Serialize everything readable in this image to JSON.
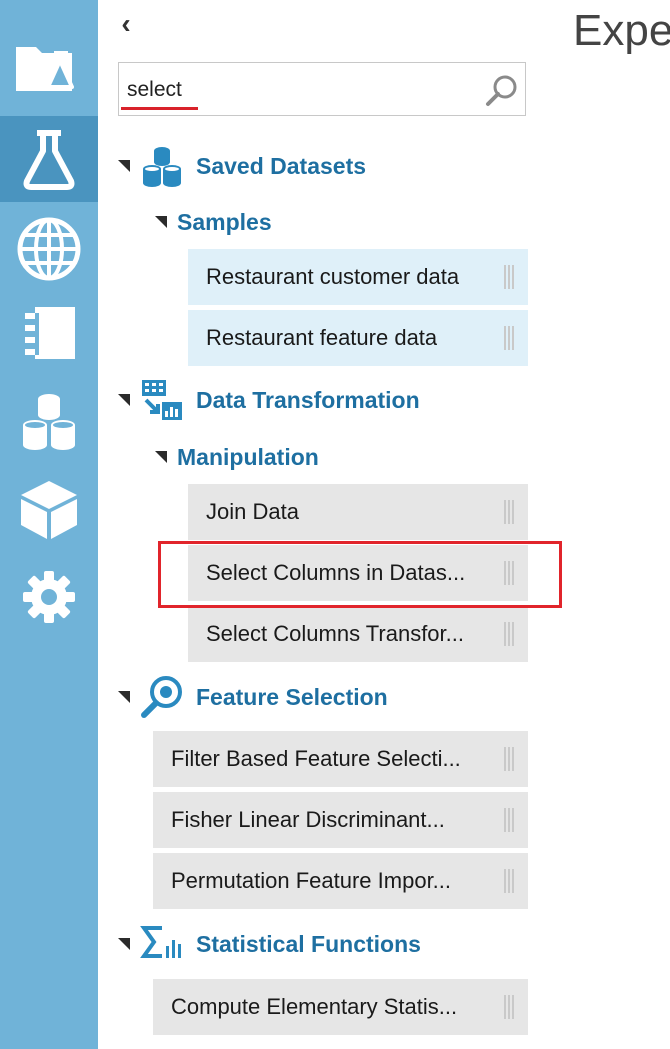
{
  "rail": {
    "items": [
      {
        "icon": "projects-icon",
        "active": false
      },
      {
        "icon": "experiments-icon",
        "active": true
      },
      {
        "icon": "web-services-icon",
        "active": false
      },
      {
        "icon": "notebooks-icon",
        "active": false
      },
      {
        "icon": "datasets-icon",
        "active": false
      },
      {
        "icon": "trained-models-icon",
        "active": false
      },
      {
        "icon": "settings-icon",
        "active": false
      }
    ]
  },
  "palette": {
    "collapse_glyph": "‹",
    "search": {
      "value": "select",
      "placeholder": ""
    },
    "groups": [
      {
        "title": "Saved Datasets",
        "icon": "saved-datasets-icon",
        "subgroups": [
          {
            "title": "Samples",
            "items": [
              "Restaurant customer data",
              "Restaurant feature data"
            ]
          }
        ]
      },
      {
        "title": "Data Transformation",
        "icon": "data-transformation-icon",
        "subgroups": [
          {
            "title": "Manipulation",
            "items": [
              "Join Data",
              "Select Columns in Datas...",
              "Select Columns Transfor..."
            ]
          }
        ]
      },
      {
        "title": "Feature Selection",
        "icon": "feature-selection-icon",
        "items": [
          "Filter Based Feature Selecti...",
          "Fisher Linear Discriminant...",
          "Permutation Feature Impor..."
        ]
      },
      {
        "title": "Statistical Functions",
        "icon": "statistical-functions-icon",
        "items": [
          "Compute Elementary Statis..."
        ]
      }
    ]
  },
  "canvas": {
    "title": "Expe"
  },
  "colors": {
    "rail": "#70b3d8",
    "rail_active": "#4a94bf",
    "heading": "#1e6fa1",
    "sample_item_bg": "#dff0f9",
    "module_item_bg": "#e6e6e6",
    "highlight": "#e1242b"
  }
}
